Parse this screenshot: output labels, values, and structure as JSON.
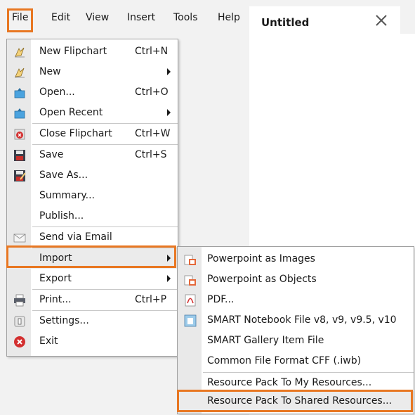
{
  "menubar": {
    "items": [
      "File",
      "Edit",
      "View",
      "Insert",
      "Tools",
      "Help"
    ]
  },
  "tab": {
    "title": "Untitled",
    "close_icon": "close-icon"
  },
  "file_menu": {
    "new_flipchart": {
      "label": "New Flipchart",
      "shortcut": "Ctrl+N"
    },
    "new": {
      "label": "New"
    },
    "open": {
      "label": "Open...",
      "shortcut": "Ctrl+O"
    },
    "open_recent": {
      "label": "Open Recent"
    },
    "close_flipchart": {
      "label": "Close Flipchart",
      "shortcut": "Ctrl+W"
    },
    "save": {
      "label": "Save",
      "shortcut": "Ctrl+S"
    },
    "save_as": {
      "label": "Save As..."
    },
    "summary": {
      "label": "Summary..."
    },
    "publish": {
      "label": "Publish..."
    },
    "send_email": {
      "label": "Send via Email"
    },
    "import": {
      "label": "Import"
    },
    "export": {
      "label": "Export"
    },
    "print": {
      "label": "Print...",
      "shortcut": "Ctrl+P"
    },
    "settings": {
      "label": "Settings..."
    },
    "exit": {
      "label": "Exit"
    }
  },
  "import_menu": {
    "items": [
      "Powerpoint as Images",
      "Powerpoint as Objects",
      "PDF...",
      "SMART Notebook File v8, v9, v9.5, v10",
      "SMART Gallery Item File",
      "Common File Format CFF (.iwb)",
      "Resource Pack To My Resources...",
      "Resource Pack To Shared Resources..."
    ]
  },
  "colors": {
    "highlight": "#e87722",
    "menubar_bg": "#f2f2f2",
    "gutter": "#e9e9e9"
  }
}
